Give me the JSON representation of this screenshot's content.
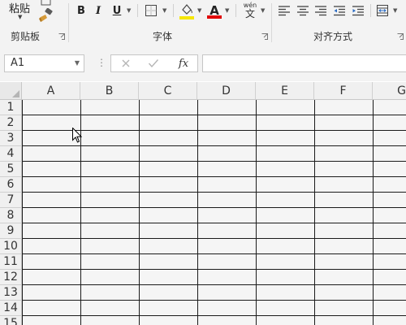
{
  "ribbon": {
    "clipboard": {
      "paste_label": "粘贴",
      "group_label": "剪贴板"
    },
    "font": {
      "group_label": "字体",
      "bold": "B",
      "italic": "I",
      "underline": "U",
      "font_color_letter": "A",
      "fill_color": "#f5e600",
      "font_color": "#e00000",
      "phonetic_top": "wén",
      "phonetic_bottom": "文"
    },
    "alignment": {
      "group_label": "对齐方式"
    }
  },
  "formula_bar": {
    "name_box": "A1",
    "fx_label": "fx",
    "formula_value": ""
  },
  "grid": {
    "columns": [
      "A",
      "B",
      "C",
      "D",
      "E",
      "F",
      "G"
    ],
    "rows": [
      "1",
      "2",
      "3",
      "4",
      "5",
      "6",
      "7",
      "8",
      "9",
      "10",
      "11",
      "12",
      "13",
      "14",
      "15"
    ]
  }
}
